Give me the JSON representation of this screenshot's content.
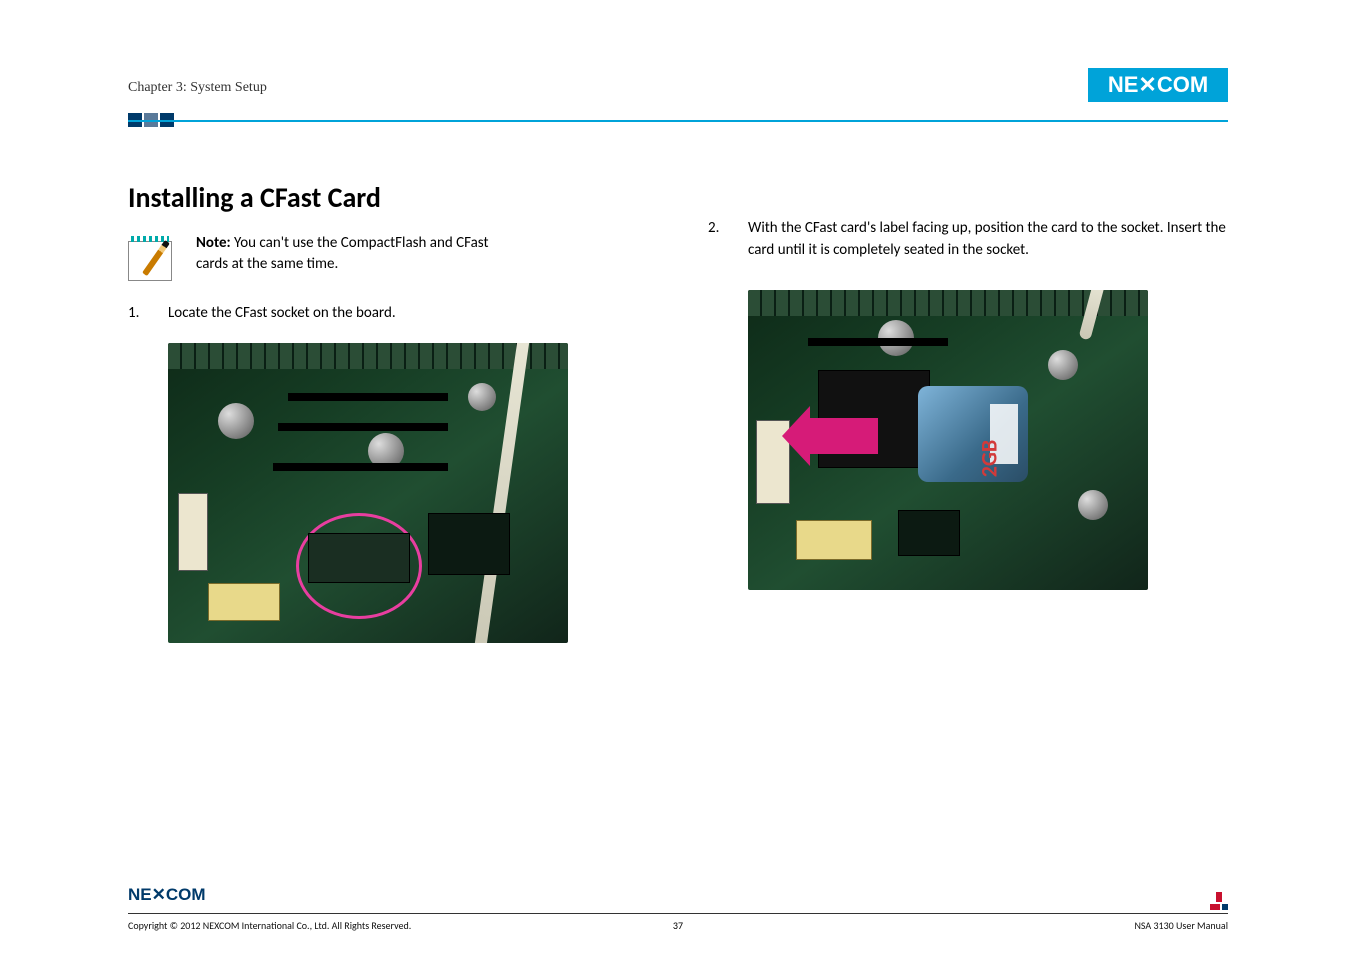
{
  "header": {
    "chapter": "Chapter 3: System Setup",
    "brand": "NEXCOM"
  },
  "heading": "Installing a CFast Card",
  "note": {
    "label": "Note:",
    "text": " You can't use the CompactFlash and CFast cards at the same time."
  },
  "left": {
    "step_num": "1.",
    "step_text": "Locate the CFast socket on the board."
  },
  "right": {
    "step_num": "2.",
    "step_text": "With the CFast card's label facing up, position the card to the socket. Insert the card until it is completely seated in the socket."
  },
  "card_label": "2GB",
  "footer": {
    "copyright": "Copyright © 2012 NEXCOM International Co., Ltd. All Rights Reserved.",
    "page": "37",
    "manual": "NSA 3130 User Manual"
  }
}
